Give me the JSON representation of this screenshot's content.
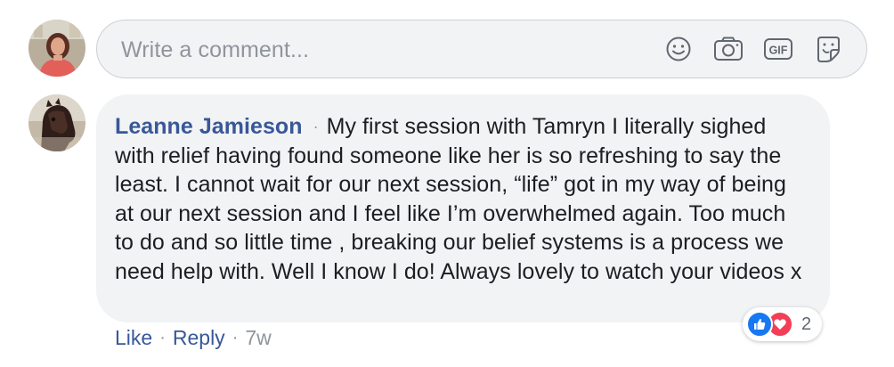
{
  "composer": {
    "placeholder": "Write a comment...",
    "icons": [
      "emoji-icon",
      "camera-icon",
      "gif-icon",
      "sticker-icon"
    ],
    "gif_label": "GIF"
  },
  "comment": {
    "author": "Leanne Jamieson",
    "separator": "·",
    "text": "My first session with Tamryn I literally sighed with relief having found someone like her is so refreshing to say the least. I cannot wait for our next session, “life” got in my way of being at our next session and I feel like I’m overwhelmed again. Too much to do and so little time , breaking our belief systems is a process we need help with. Well I know I do! Always lovely to watch your videos x",
    "like_label": "Like",
    "reply_label": "Reply",
    "action_separator": "·",
    "timestamp": "7w",
    "reactions": {
      "types": [
        "like",
        "love"
      ],
      "count": "2"
    }
  },
  "colors": {
    "link": "#385898",
    "bubble_bg": "#f2f3f5",
    "muted": "#90949c",
    "like_blue": "#1877f2",
    "love_red": "#f33e58"
  }
}
